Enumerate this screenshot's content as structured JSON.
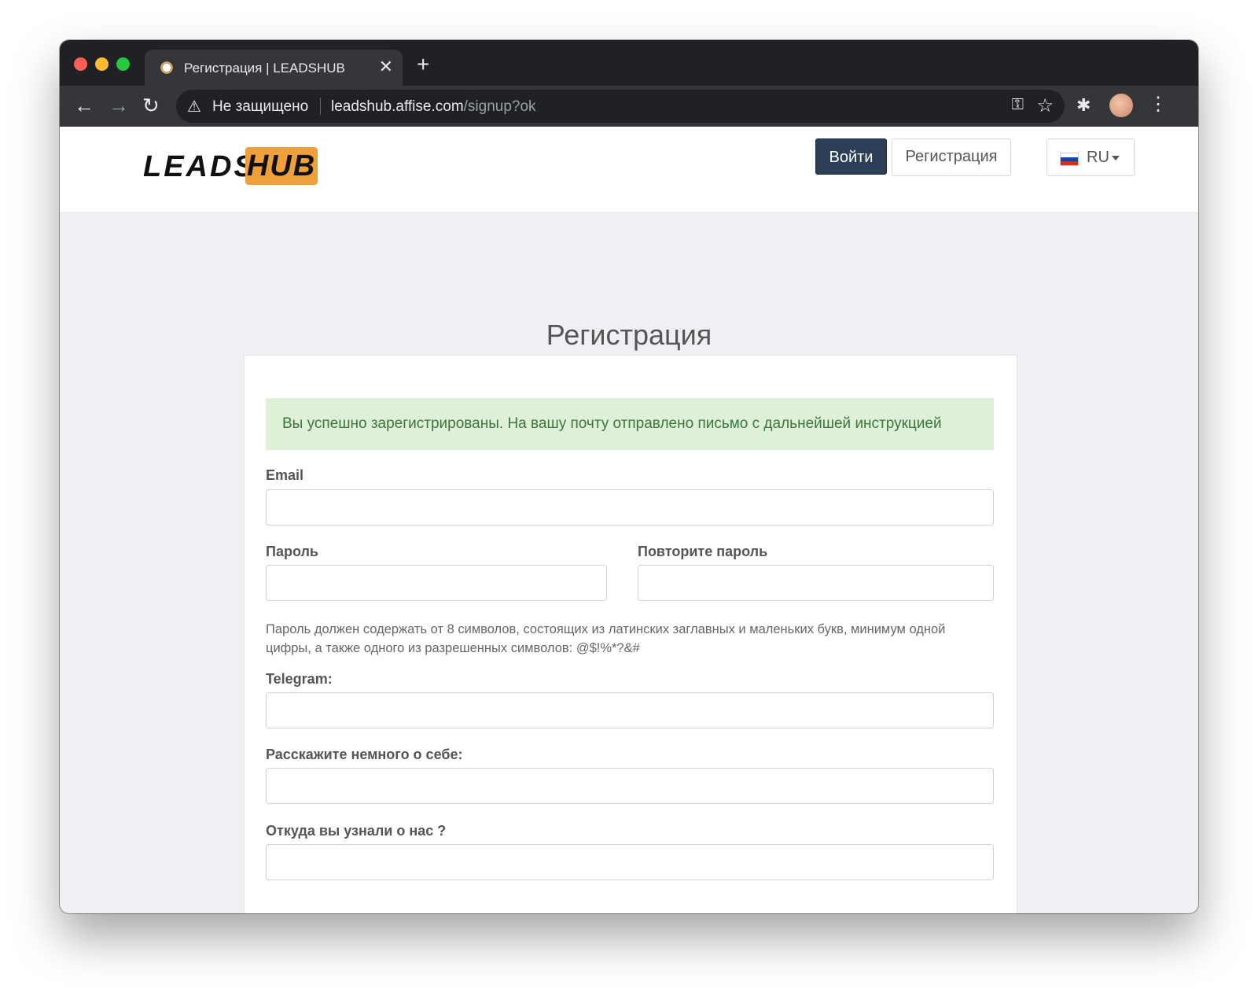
{
  "browser": {
    "tab_title": "Регистрация | LEADSHUB",
    "tab_close": "✕",
    "new_tab": "+",
    "security_label": "Не защищено",
    "url_host": "leadshub.affise.com",
    "url_path": "/signup?ok",
    "icons": [
      "back-arrow-icon",
      "forward-arrow-icon",
      "reload-icon",
      "warning-icon",
      "key-icon",
      "star-icon",
      "extensions-icon",
      "kebab-menu-icon"
    ]
  },
  "header": {
    "logo_leads": "LEADS",
    "logo_hub": "HUB",
    "login_button": "Войти",
    "register_button": "Регистрация",
    "language": "RU"
  },
  "page": {
    "title": "Регистрация"
  },
  "form": {
    "success_message": "Вы успешно зарегистрированы. На вашу почту отправлено письмо с дальнейшей инструкцией",
    "email_label": "Email",
    "email_value": "",
    "password_label": "Пароль",
    "password_value": "",
    "password_repeat_label": "Повторите пароль",
    "password_repeat_value": "",
    "password_hint": "Пароль должен содержать от 8 символов, состоящих из латинских заглавных и маленьких букв, минимум одной цифры, а также одного из разрешенных символов: @$!%*?&#",
    "telegram_label": "Telegram:",
    "telegram_value": "",
    "about_label": "Расскажите немного о себе:",
    "about_value": "",
    "source_label": "Откуда вы узнали о нас ?",
    "source_value": ""
  },
  "colors": {
    "accent_dark": "#2d3e57",
    "logo_orange": "#f0a03a",
    "success_bg": "#dff0d8",
    "success_text": "#3c763d"
  }
}
